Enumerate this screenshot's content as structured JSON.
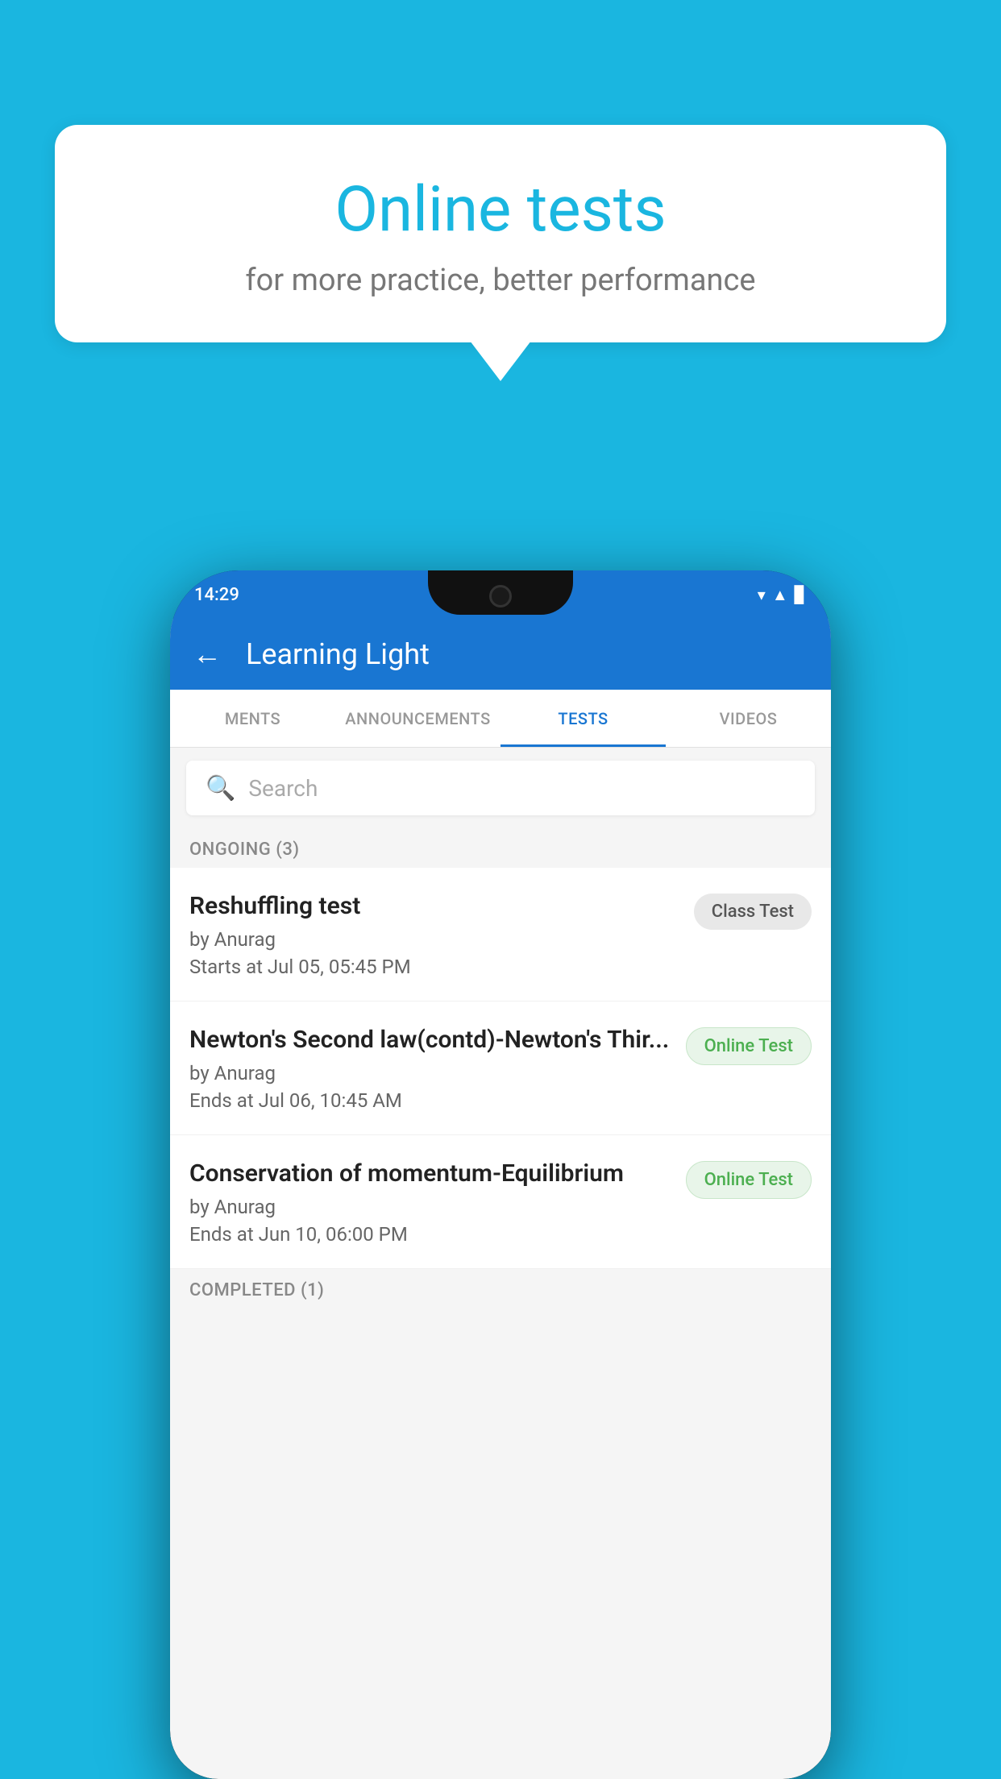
{
  "background_color": "#1ab6e0",
  "speech_bubble": {
    "title": "Online tests",
    "subtitle": "for more practice, better performance"
  },
  "phone": {
    "status_bar": {
      "time": "14:29",
      "icons": [
        "▼",
        "▲",
        "▌"
      ]
    },
    "app_bar": {
      "title": "Learning Light",
      "back_label": "←"
    },
    "tabs": [
      {
        "label": "MENTS",
        "active": false
      },
      {
        "label": "ANNOUNCEMENTS",
        "active": false
      },
      {
        "label": "TESTS",
        "active": true
      },
      {
        "label": "VIDEOS",
        "active": false
      }
    ],
    "search": {
      "placeholder": "Search"
    },
    "sections": [
      {
        "header": "ONGOING (3)",
        "items": [
          {
            "title": "Reshuffling test",
            "by": "by Anurag",
            "time": "Starts at  Jul 05, 05:45 PM",
            "badge": "Class Test",
            "badge_type": "class"
          },
          {
            "title": "Newton's Second law(contd)-Newton's Thir...",
            "by": "by Anurag",
            "time": "Ends at  Jul 06, 10:45 AM",
            "badge": "Online Test",
            "badge_type": "online"
          },
          {
            "title": "Conservation of momentum-Equilibrium",
            "by": "by Anurag",
            "time": "Ends at  Jun 10, 06:00 PM",
            "badge": "Online Test",
            "badge_type": "online"
          }
        ]
      },
      {
        "header": "COMPLETED (1)",
        "items": []
      }
    ]
  }
}
